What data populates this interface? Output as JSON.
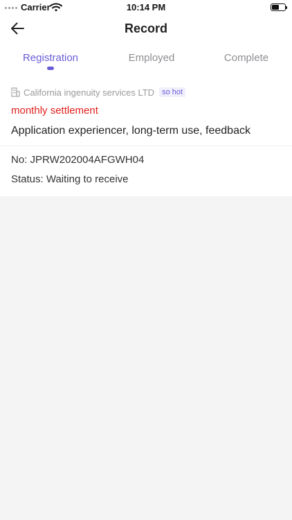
{
  "status_bar": {
    "carrier": "Carrier",
    "time": "10:14 PM",
    "battery_level": 0.55
  },
  "nav": {
    "title": "Record",
    "back_icon": "arrow-left-icon"
  },
  "tabs": [
    {
      "label": "Registration",
      "active": true
    },
    {
      "label": "Employed",
      "active": false
    },
    {
      "label": "Complete",
      "active": false
    }
  ],
  "record": {
    "company_icon": "building-icon",
    "company": "California ingenuity services LTD",
    "badge": "so hot",
    "settlement": "monthly settlement",
    "title": "Application experiencer, long-term use, feedback",
    "number": "No: JPRW202004AFGWH04",
    "status": "Status: Waiting to receive"
  },
  "colors": {
    "accent": "#6a5cd8",
    "settlement_red": "#e0201c",
    "page_background": "#f4f4f5"
  }
}
